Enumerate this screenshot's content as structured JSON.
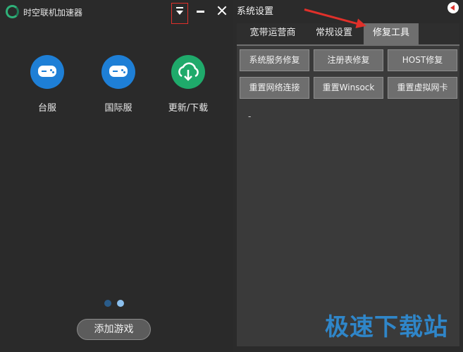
{
  "app": {
    "title": "时空联机加速器",
    "apps": [
      {
        "label": "台服",
        "icon": "gamepad-icon",
        "color": "#1e7fd6"
      },
      {
        "label": "国际服",
        "icon": "gamepad-icon",
        "color": "#1e7fd6"
      },
      {
        "label": "更新/下载",
        "icon": "cloud-download-icon",
        "color": "#1faa6b"
      }
    ],
    "pagination": {
      "dots": 2,
      "active": 2
    },
    "add_game_label": "添加游戏"
  },
  "settings": {
    "title": "系统设置",
    "tabs": [
      {
        "label": "宽带运营商",
        "active": false
      },
      {
        "label": "常规设置",
        "active": false
      },
      {
        "label": "修复工具",
        "active": true
      }
    ],
    "buttons": [
      "系统服务修复",
      "注册表修复",
      "HOST修复",
      "重置网络连接",
      "重置Winsock",
      "重置虚拟网卡"
    ],
    "output": "-"
  },
  "watermark": "极速下载站",
  "colors": {
    "accent_red": "#e0302a",
    "blue": "#1e7fd6",
    "green": "#1faa6b"
  }
}
